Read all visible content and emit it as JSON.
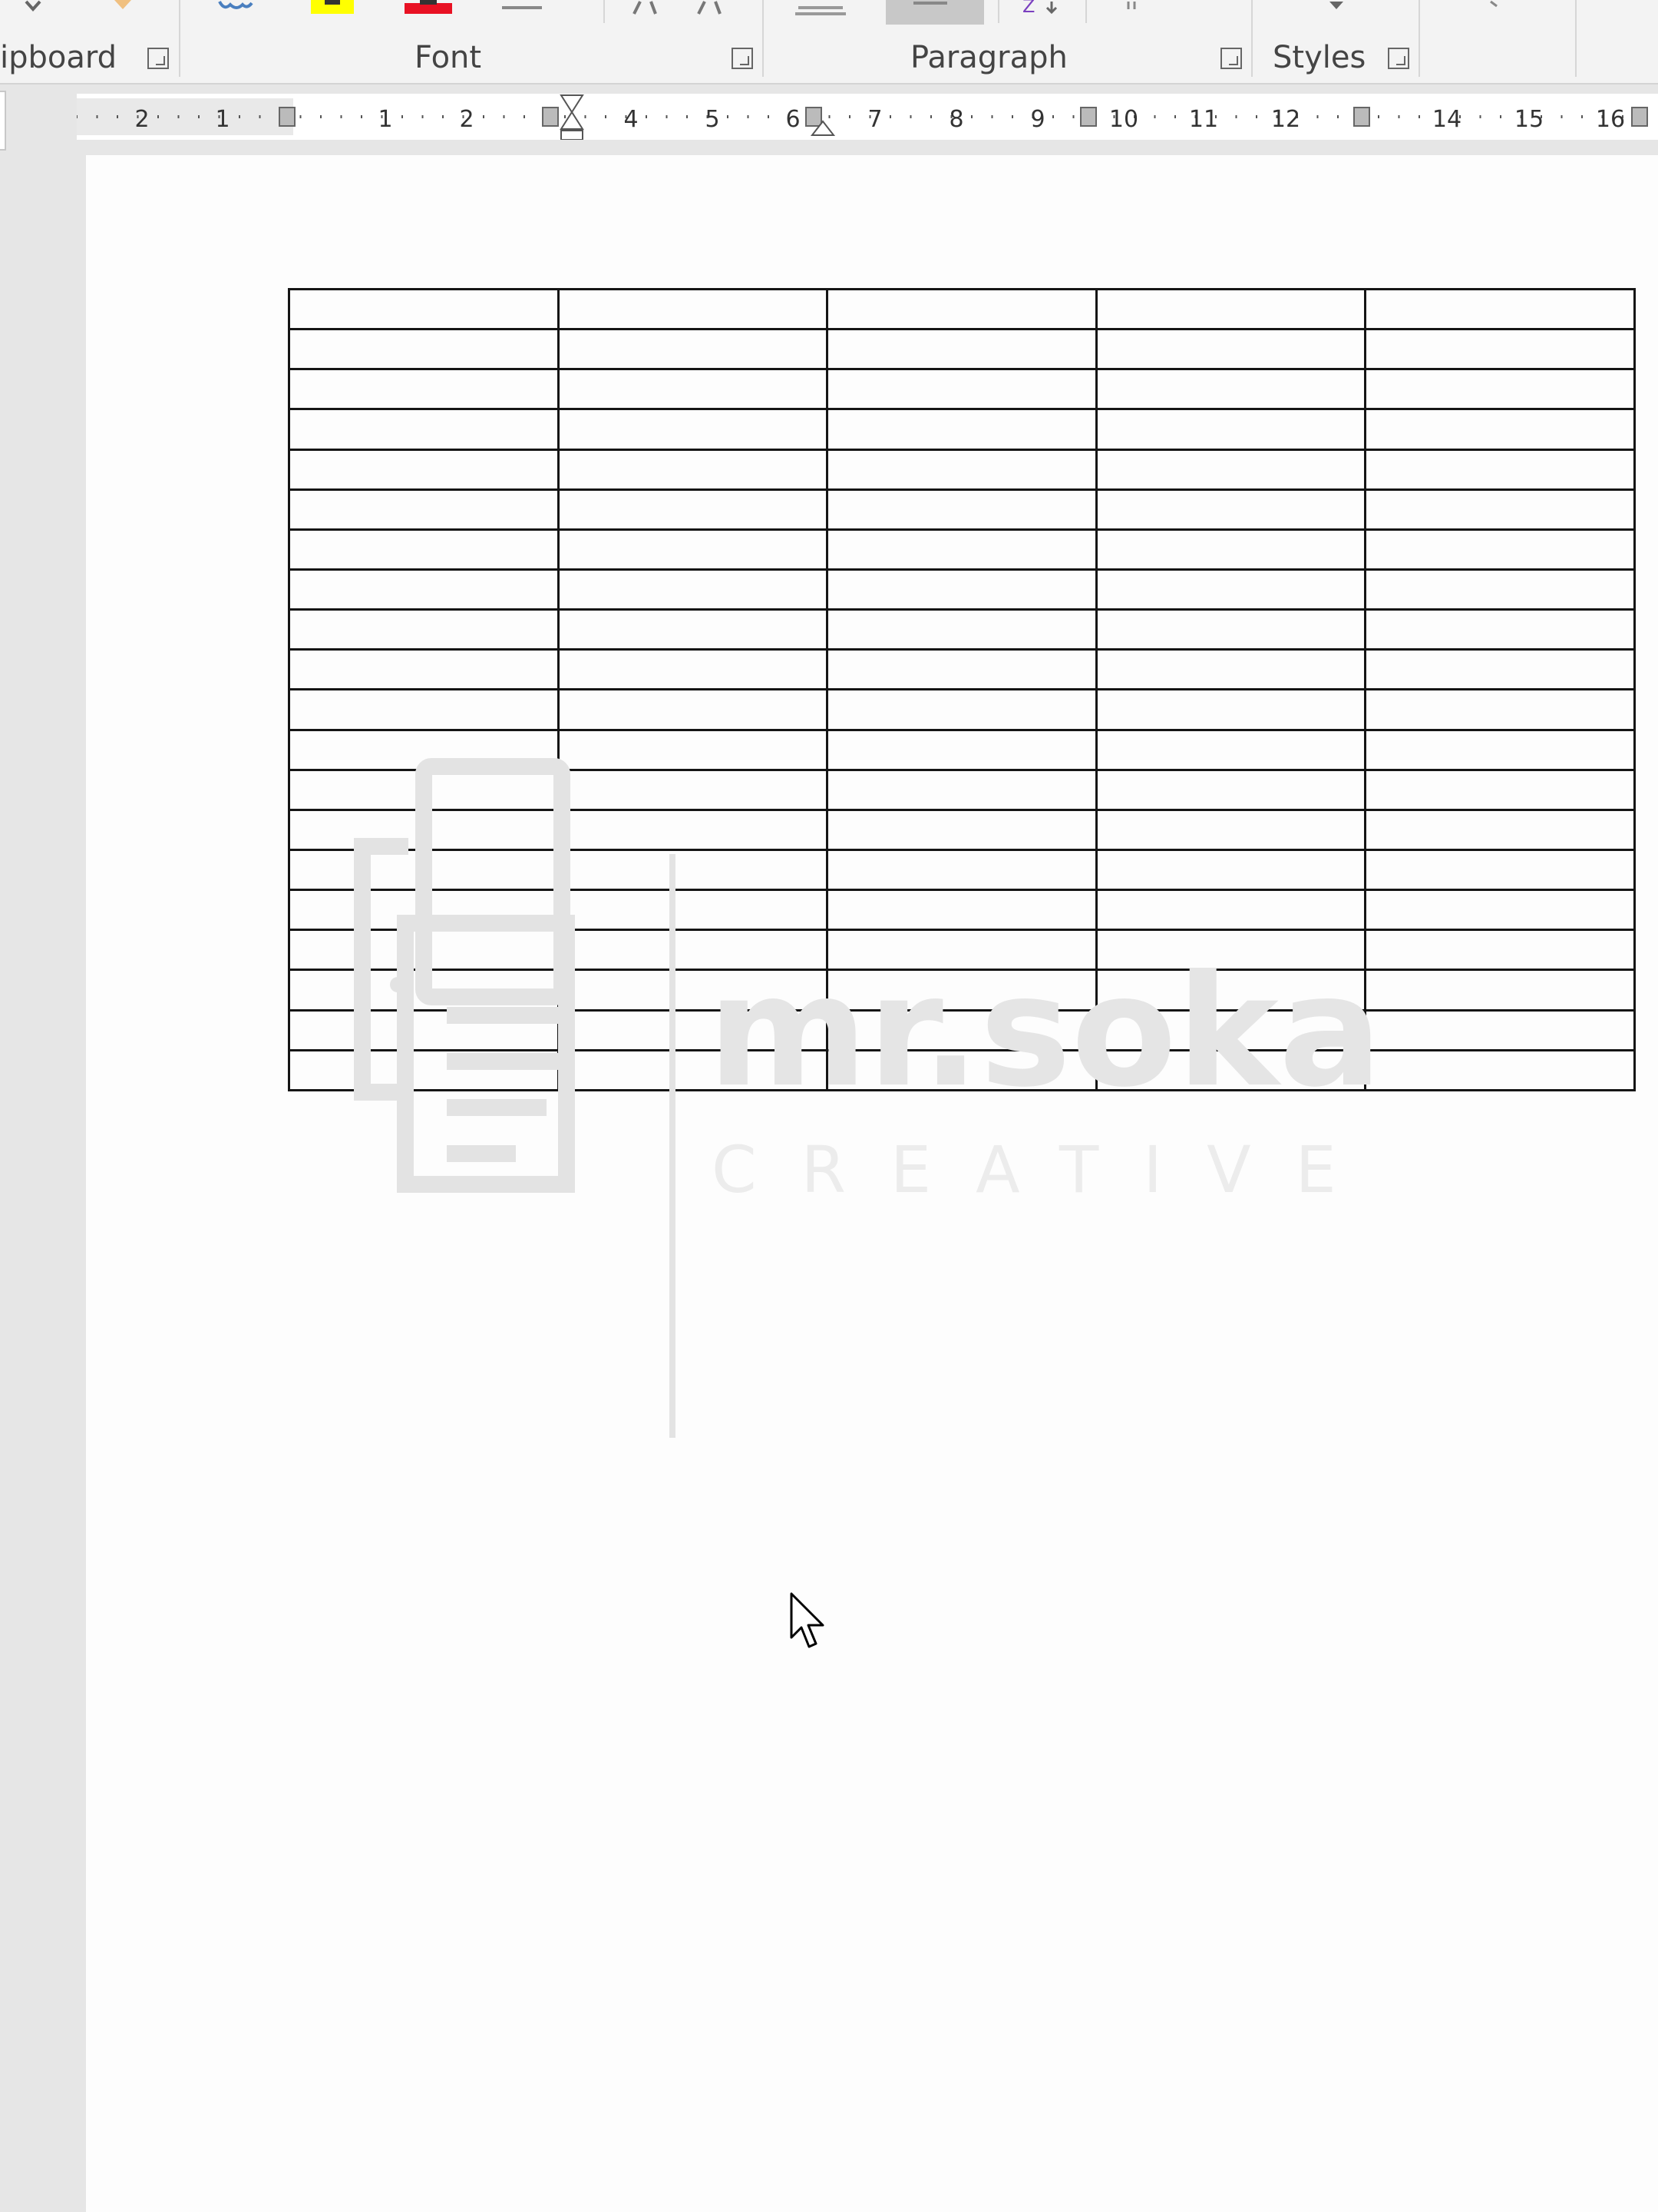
{
  "ribbon": {
    "groups": {
      "clipboard": "ipboard",
      "font": "Font",
      "paragraph": "Paragraph",
      "styles": "Styles"
    },
    "icons": [
      "format-painter-icon",
      "text-effects-icon",
      "highlight-color-icon",
      "font-color-icon",
      "change-case-icon",
      "grow-font-icon",
      "shrink-font-icon",
      "borders-icon",
      "shading-icon",
      "sort-icon",
      "show-marks-icon"
    ],
    "colors": {
      "highlight": "#ffff00",
      "font_color": "#e81123"
    }
  },
  "ruler": {
    "labels": [
      "2",
      "1",
      "1",
      "2",
      "4",
      "5",
      "6",
      "7",
      "8",
      "9",
      "10",
      "11",
      "12",
      "14",
      "15",
      "16"
    ]
  },
  "document": {
    "table": {
      "rows": 20,
      "cols": 5
    }
  },
  "watermark": {
    "brand": "mr.soka",
    "tagline": "CREATIVE"
  }
}
